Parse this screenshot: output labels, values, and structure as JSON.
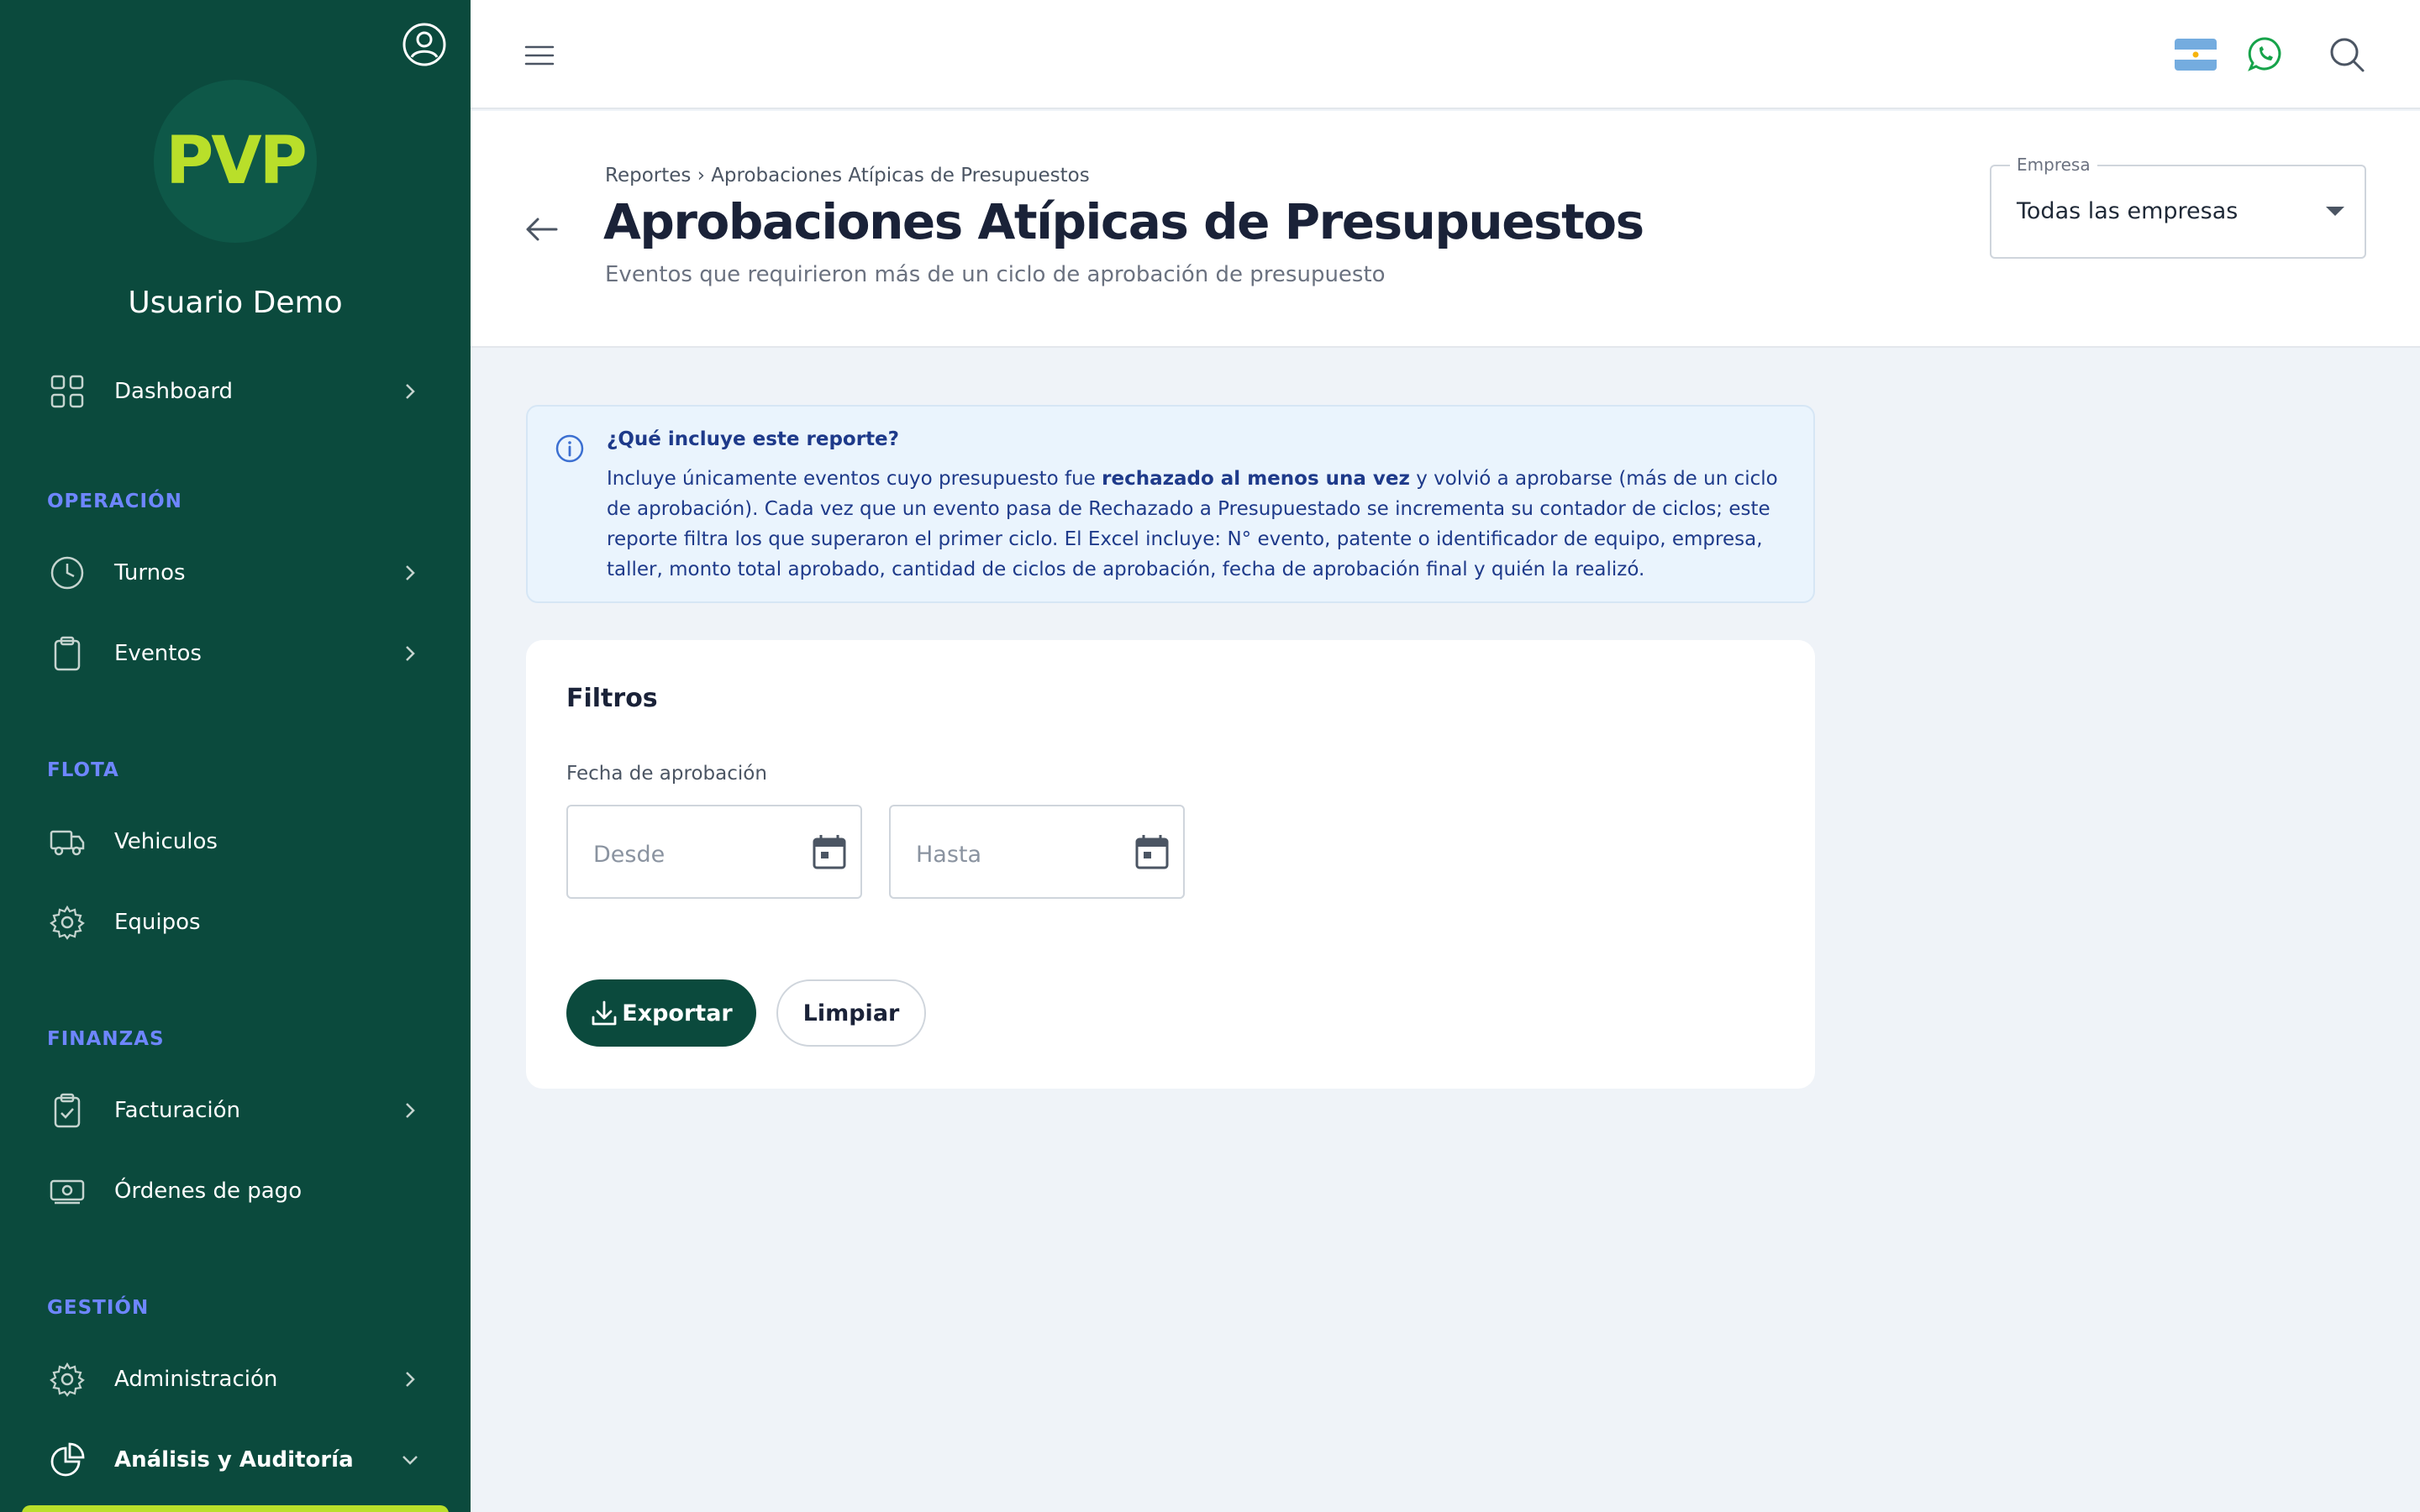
{
  "sidebar": {
    "logo_text": "PVP",
    "username": "Usuario Demo",
    "items": {
      "dashboard": "Dashboard",
      "turnos": "Turnos",
      "eventos": "Eventos",
      "vehiculos": "Vehiculos",
      "equipos": "Equipos",
      "facturacion": "Facturación",
      "ordenes": "Órdenes de pago",
      "administracion": "Administración",
      "analisis": "Análisis y Auditoría"
    },
    "sections": {
      "operacion": "OPERACIÓN",
      "flota": "FLOTA",
      "finanzas": "FINANZAS",
      "gestion": "GESTIÓN"
    }
  },
  "header": {
    "breadcrumb": "Reportes › Aprobaciones Atípicas de Presupuestos",
    "title": "Aprobaciones Atípicas de Presupuestos",
    "subtitle": "Eventos que requirieron más de un ciclo de aprobación de presupuesto",
    "empresa_label": "Empresa",
    "empresa_value": "Todas las empresas"
  },
  "info": {
    "title": "¿Qué incluye este reporte?",
    "text_before": "Incluye únicamente eventos cuyo presupuesto fue ",
    "text_bold": "rechazado al menos una vez",
    "text_after": " y volvió a aprobarse (más de un ciclo de aprobación). Cada vez que un evento pasa de Rechazado a Presupuestado se incrementa su contador de ciclos; este reporte filtra los que superaron el primer ciclo. El Excel incluye: N° evento, patente o identificador de equipo, empresa, taller, monto total aprobado, cantidad de ciclos de aprobación, fecha de aprobación final y quién la realizó."
  },
  "filters": {
    "title": "Filtros",
    "fecha_label": "Fecha de aprobación",
    "desde_placeholder": "Desde",
    "hasta_placeholder": "Hasta",
    "export_label": "Exportar",
    "clear_label": "Limpiar"
  },
  "colors": {
    "sidebar_bg": "#0b4a3d",
    "accent": "#b9df2a",
    "section_title": "#6e86ff",
    "info_text": "#1e3a8a"
  },
  "icons": {
    "profile": "user-circle-icon",
    "menu": "hamburger-icon",
    "flag": "argentina-flag-icon",
    "whatsapp": "whatsapp-icon",
    "search": "search-icon",
    "back": "arrow-left-icon",
    "info": "info-icon",
    "calendar": "calendar-icon",
    "download": "download-icon"
  }
}
